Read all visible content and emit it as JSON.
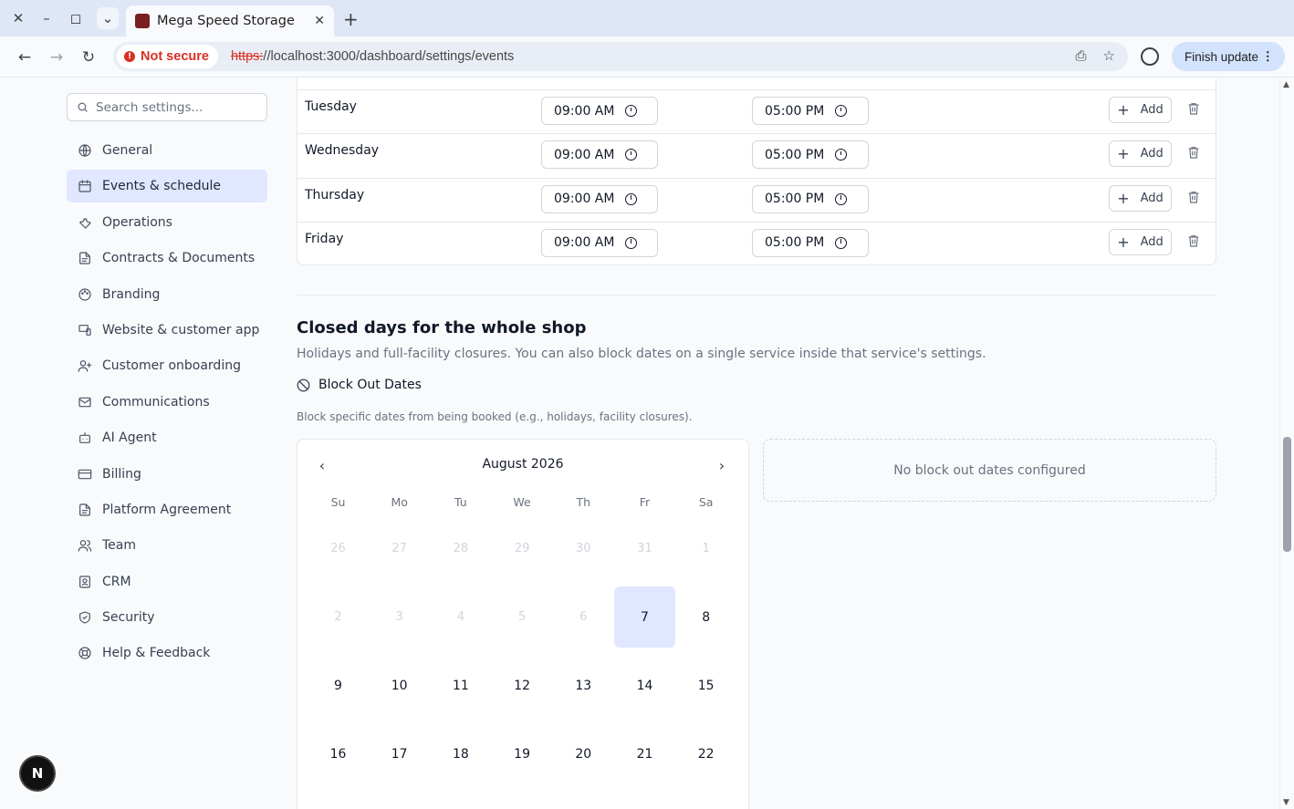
{
  "browser": {
    "tab_title": "Mega Speed Storage",
    "not_secure": "Not secure",
    "url_scheme": "https:",
    "url_rest": "//localhost:3000/dashboard/settings/events",
    "finish_update": "Finish update"
  },
  "sidebar": {
    "search_placeholder": "Search settings...",
    "items": [
      {
        "label": "General",
        "icon": "globe-icon"
      },
      {
        "label": "Events & schedule",
        "icon": "calendar-icon"
      },
      {
        "label": "Operations",
        "icon": "wrench-icon"
      },
      {
        "label": "Contracts & Documents",
        "icon": "document-icon"
      },
      {
        "label": "Branding",
        "icon": "palette-icon"
      },
      {
        "label": "Website & customer app",
        "icon": "devices-icon"
      },
      {
        "label": "Customer onboarding",
        "icon": "user-plus-icon"
      },
      {
        "label": "Communications",
        "icon": "mail-icon"
      },
      {
        "label": "AI Agent",
        "icon": "bot-icon"
      },
      {
        "label": "Billing",
        "icon": "credit-card-icon"
      },
      {
        "label": "Platform Agreement",
        "icon": "document-icon"
      },
      {
        "label": "Team",
        "icon": "users-icon"
      },
      {
        "label": "CRM",
        "icon": "contact-icon"
      },
      {
        "label": "Security",
        "icon": "shield-icon"
      },
      {
        "label": "Help & Feedback",
        "icon": "lifebuoy-icon"
      }
    ],
    "badge": "N"
  },
  "hours": {
    "rows": [
      {
        "day": "Tuesday",
        "open": "09:00 AM",
        "close": "05:00 PM",
        "add": "Add"
      },
      {
        "day": "Wednesday",
        "open": "09:00 AM",
        "close": "05:00 PM",
        "add": "Add"
      },
      {
        "day": "Thursday",
        "open": "09:00 AM",
        "close": "05:00 PM",
        "add": "Add"
      },
      {
        "day": "Friday",
        "open": "09:00 AM",
        "close": "05:00 PM",
        "add": "Add"
      }
    ]
  },
  "closed": {
    "title": "Closed days for the whole shop",
    "description": "Holidays and full-facility closures. You can also block dates on a single service inside that service's settings.",
    "block_title": "Block Out Dates",
    "block_desc": "Block specific dates from being booked (e.g., holidays, facility closures).",
    "empty": "No block out dates configured"
  },
  "calendar": {
    "month": "August 2026",
    "weekdays": [
      "Su",
      "Mo",
      "Tu",
      "We",
      "Th",
      "Fr",
      "Sa"
    ],
    "weeks": [
      [
        {
          "d": "26",
          "m": true
        },
        {
          "d": "27",
          "m": true
        },
        {
          "d": "28",
          "m": true
        },
        {
          "d": "29",
          "m": true
        },
        {
          "d": "30",
          "m": true
        },
        {
          "d": "31",
          "m": true
        },
        {
          "d": "1",
          "m": true
        }
      ],
      [
        {
          "d": "2",
          "m": true
        },
        {
          "d": "3",
          "m": true
        },
        {
          "d": "4",
          "m": true
        },
        {
          "d": "5",
          "m": true
        },
        {
          "d": "6",
          "m": true
        },
        {
          "d": "7",
          "sel": true
        },
        {
          "d": "8"
        }
      ],
      [
        {
          "d": "9"
        },
        {
          "d": "10"
        },
        {
          "d": "11"
        },
        {
          "d": "12"
        },
        {
          "d": "13"
        },
        {
          "d": "14"
        },
        {
          "d": "15"
        }
      ],
      [
        {
          "d": "16"
        },
        {
          "d": "17"
        },
        {
          "d": "18"
        },
        {
          "d": "19"
        },
        {
          "d": "20"
        },
        {
          "d": "21"
        },
        {
          "d": "22"
        }
      ]
    ]
  }
}
